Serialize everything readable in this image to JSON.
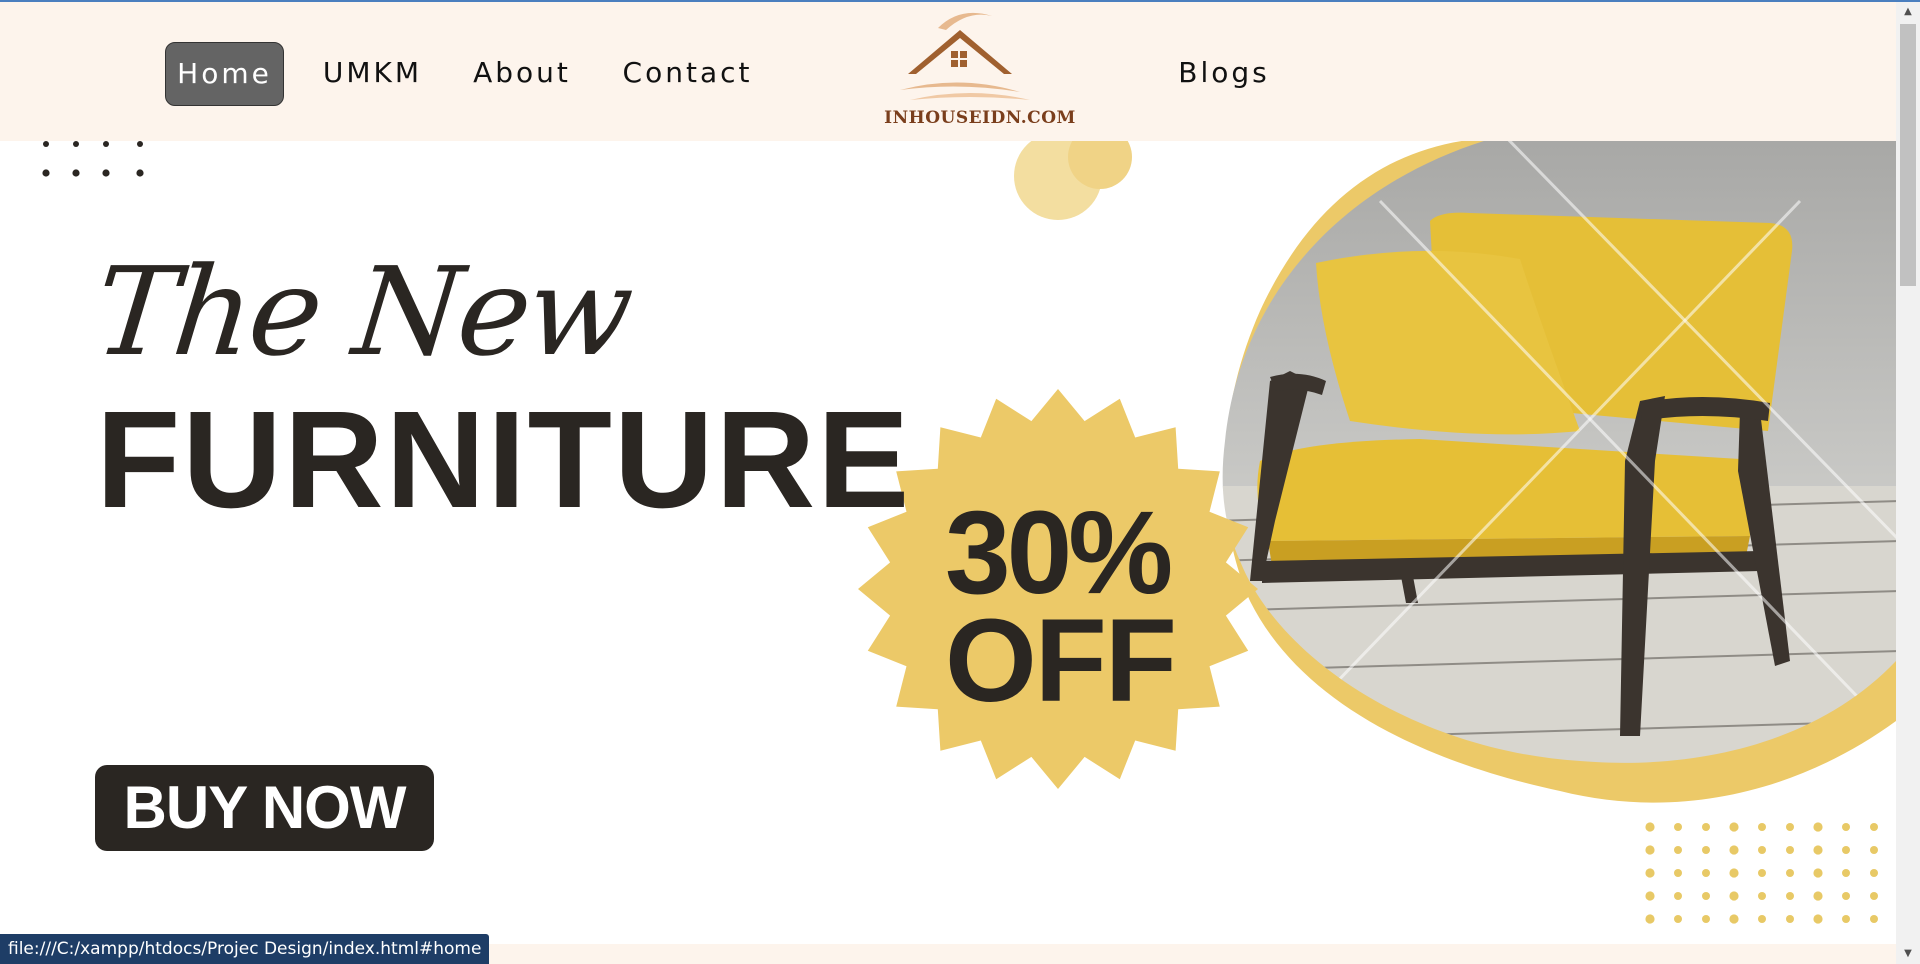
{
  "nav": {
    "items": [
      {
        "label": "Home",
        "active": true
      },
      {
        "label": "UMKM"
      },
      {
        "label": "About"
      },
      {
        "label": "Contact"
      },
      {
        "label": "Blogs"
      }
    ]
  },
  "logo": {
    "text": "INHOUSEIDN.COM"
  },
  "hero": {
    "script_title": "The New",
    "main_title": "FURNITURE",
    "badge_percent": "30%",
    "badge_off": "OFF",
    "cta_label": "BUY NOW"
  },
  "status": {
    "url": "file:///C:/xampp/htdocs/Projec Design/index.html#home"
  },
  "colors": {
    "header_bg": "#fdf4ec",
    "accent_yellow": "#ecc968",
    "dark": "#2a2622",
    "nav_active_bg": "#646464",
    "status_bg": "#1e3d66"
  }
}
